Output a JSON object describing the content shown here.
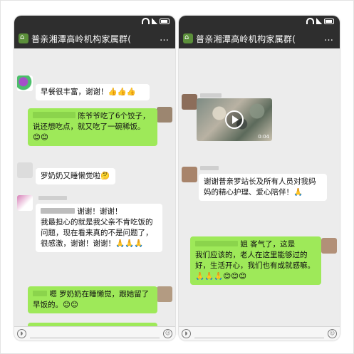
{
  "group_title": "普亲湘潭高岭机构家属群(",
  "title_more": "…",
  "left_chat": {
    "messages": [
      {
        "text": "早餐很丰富，谢谢！👍👍👍"
      },
      {
        "text": "陈爷爷吃了6个饺子，说还想吃点，就又吃了一碗稀饭。😊😊"
      },
      {
        "text": "罗奶奶又睡懒觉啦🤔"
      },
      {
        "line1": "谢谢！谢谢！",
        "line2": "我最担心的就是我父亲不肯吃饭的问题，现在看来真的不是问题了，很感激，谢谢！谢谢！🙏🙏🙏"
      },
      {
        "text": "嗯 罗奶奶在睡懒觉，跟她留了早饭的。😊😊"
      }
    ]
  },
  "right_chat": {
    "video_duration": "0:04",
    "messages": [
      {
        "text": "谢谢普亲罗站长及所有人员对我妈妈的精心护理、爱心陪伴！🙏"
      },
      {
        "line1": "姐 客气了，这是",
        "line2": "我们应该的，老人在这里能够过的好，生活开心，我们也有成就感嘛。🙏🙏🙏😊😊😊"
      }
    ]
  },
  "colors": {
    "header_bg": "#2e2e2e",
    "chat_bg": "#ececec",
    "bubble_green": "#9ee959",
    "bubble_white": "#ffffff"
  },
  "icons": [
    "wifi-icon",
    "signal-icon",
    "battery-icon",
    "group-icon",
    "voice-icon",
    "emoji-icon",
    "play-icon"
  ]
}
